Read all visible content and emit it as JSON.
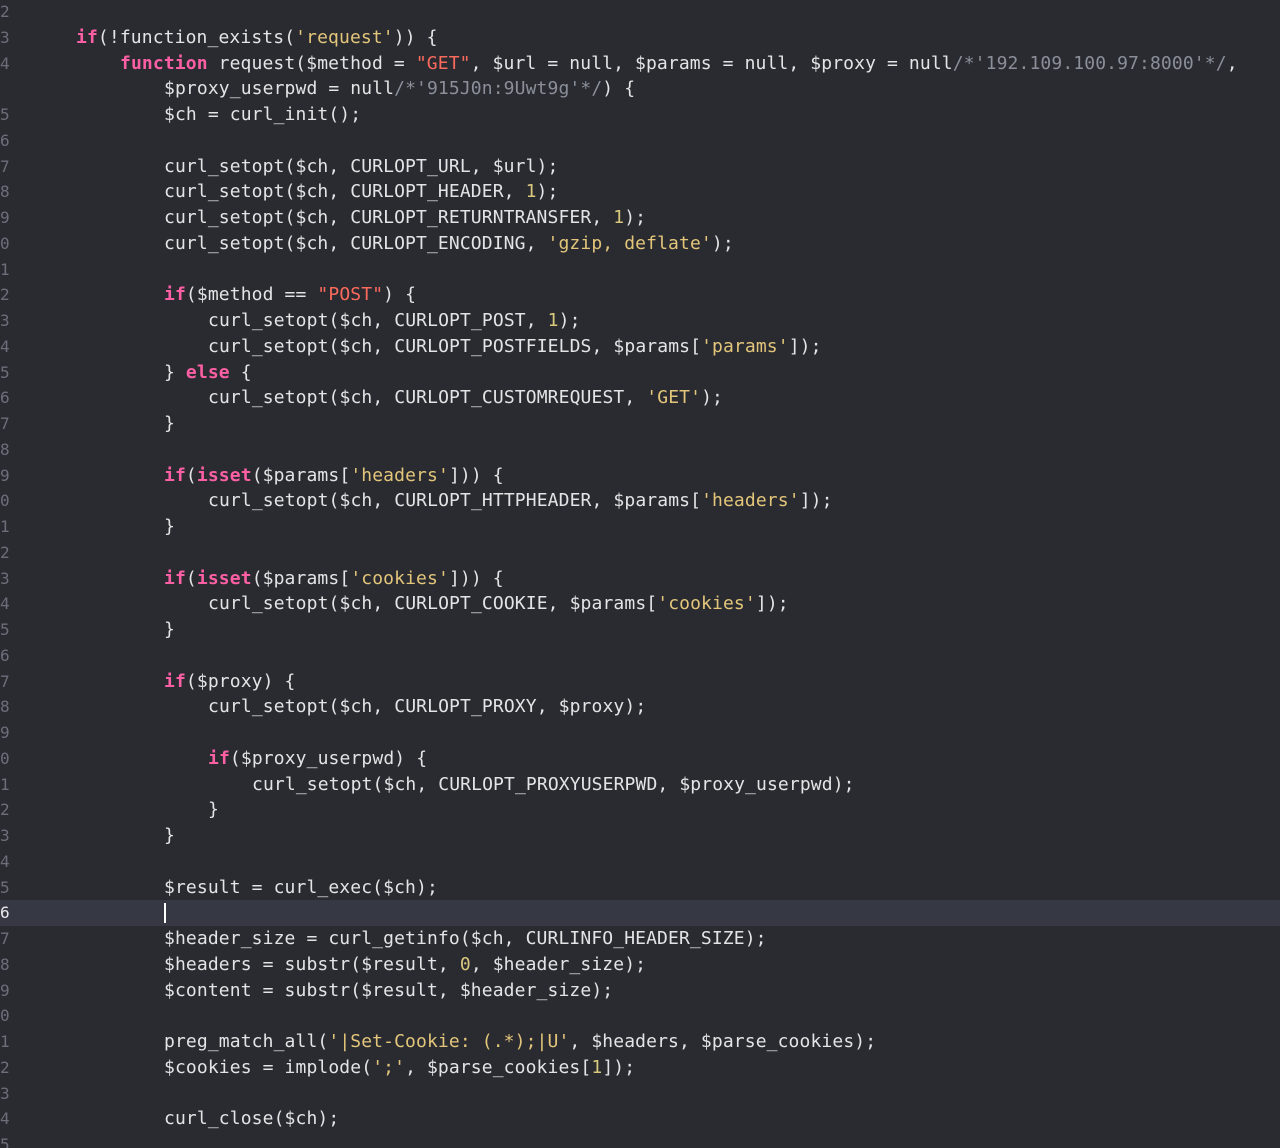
{
  "editor": {
    "theme_colors": {
      "background": "#2a2b31",
      "current_line": "#363944",
      "keyword": "#fc5fa3",
      "double_quoted_string": "#fc6a5d",
      "single_quoted_string": "#e3c67a",
      "number": "#d9c97c",
      "comment": "#8a8f99",
      "plain": "#e4e4e6",
      "line_number": "#6c6f7a"
    },
    "current_line_number": "6",
    "lines": [
      {
        "n": "2",
        "indent": 0,
        "tokens": []
      },
      {
        "n": "3",
        "indent": 1,
        "tokens": [
          {
            "t": "kw",
            "v": "if"
          },
          {
            "t": "pl",
            "v": "(!function_exists("
          },
          {
            "t": "sq",
            "v": "'request'"
          },
          {
            "t": "pl",
            "v": ")) {"
          }
        ]
      },
      {
        "n": "4",
        "indent": 2,
        "tokens": [
          {
            "t": "kw",
            "v": "function"
          },
          {
            "t": "pl",
            "v": " request($method = "
          },
          {
            "t": "str",
            "v": "\"GET\""
          },
          {
            "t": "pl",
            "v": ", $url = null, $params = null, $proxy = null"
          },
          {
            "t": "cm",
            "v": "/*'192.109.100.97:8000'*/"
          },
          {
            "t": "pl",
            "v": ","
          }
        ]
      },
      {
        "n": "",
        "indent": 3,
        "tokens": [
          {
            "t": "pl",
            "v": "$proxy_userpwd = null"
          },
          {
            "t": "cm",
            "v": "/*'915J0n:9Uwt9g'*/"
          },
          {
            "t": "pl",
            "v": ") {"
          }
        ]
      },
      {
        "n": "5",
        "indent": 3,
        "tokens": [
          {
            "t": "pl",
            "v": "$ch = curl_init();"
          }
        ]
      },
      {
        "n": "6",
        "indent": 0,
        "tokens": []
      },
      {
        "n": "7",
        "indent": 3,
        "tokens": [
          {
            "t": "pl",
            "v": "curl_setopt($ch, CURLOPT_URL, $url);"
          }
        ]
      },
      {
        "n": "8",
        "indent": 3,
        "tokens": [
          {
            "t": "pl",
            "v": "curl_setopt($ch, CURLOPT_HEADER, "
          },
          {
            "t": "num",
            "v": "1"
          },
          {
            "t": "pl",
            "v": ");"
          }
        ]
      },
      {
        "n": "9",
        "indent": 3,
        "tokens": [
          {
            "t": "pl",
            "v": "curl_setopt($ch, CURLOPT_RETURNTRANSFER, "
          },
          {
            "t": "num",
            "v": "1"
          },
          {
            "t": "pl",
            "v": ");"
          }
        ]
      },
      {
        "n": "0",
        "indent": 3,
        "tokens": [
          {
            "t": "pl",
            "v": "curl_setopt($ch, CURLOPT_ENCODING, "
          },
          {
            "t": "sq",
            "v": "'gzip, deflate'"
          },
          {
            "t": "pl",
            "v": ");"
          }
        ]
      },
      {
        "n": "1",
        "indent": 0,
        "tokens": []
      },
      {
        "n": "2",
        "indent": 3,
        "tokens": [
          {
            "t": "kw",
            "v": "if"
          },
          {
            "t": "pl",
            "v": "($method == "
          },
          {
            "t": "str",
            "v": "\"POST\""
          },
          {
            "t": "pl",
            "v": ") {"
          }
        ]
      },
      {
        "n": "3",
        "indent": 4,
        "tokens": [
          {
            "t": "pl",
            "v": "curl_setopt($ch, CURLOPT_POST, "
          },
          {
            "t": "num",
            "v": "1"
          },
          {
            "t": "pl",
            "v": ");"
          }
        ]
      },
      {
        "n": "4",
        "indent": 4,
        "tokens": [
          {
            "t": "pl",
            "v": "curl_setopt($ch, CURLOPT_POSTFIELDS, $params["
          },
          {
            "t": "sq",
            "v": "'params'"
          },
          {
            "t": "pl",
            "v": "]);"
          }
        ]
      },
      {
        "n": "5",
        "indent": 3,
        "tokens": [
          {
            "t": "pl",
            "v": "} "
          },
          {
            "t": "kw",
            "v": "else"
          },
          {
            "t": "pl",
            "v": " {"
          }
        ]
      },
      {
        "n": "6",
        "indent": 4,
        "tokens": [
          {
            "t": "pl",
            "v": "curl_setopt($ch, CURLOPT_CUSTOMREQUEST, "
          },
          {
            "t": "sq",
            "v": "'GET'"
          },
          {
            "t": "pl",
            "v": ");"
          }
        ]
      },
      {
        "n": "7",
        "indent": 3,
        "tokens": [
          {
            "t": "pl",
            "v": "}"
          }
        ]
      },
      {
        "n": "8",
        "indent": 0,
        "tokens": []
      },
      {
        "n": "9",
        "indent": 3,
        "tokens": [
          {
            "t": "kw",
            "v": "if"
          },
          {
            "t": "pl",
            "v": "("
          },
          {
            "t": "kw",
            "v": "isset"
          },
          {
            "t": "pl",
            "v": "($params["
          },
          {
            "t": "sq",
            "v": "'headers'"
          },
          {
            "t": "pl",
            "v": "])) {"
          }
        ]
      },
      {
        "n": "0",
        "indent": 4,
        "tokens": [
          {
            "t": "pl",
            "v": "curl_setopt($ch, CURLOPT_HTTPHEADER, $params["
          },
          {
            "t": "sq",
            "v": "'headers'"
          },
          {
            "t": "pl",
            "v": "]);"
          }
        ]
      },
      {
        "n": "1",
        "indent": 3,
        "tokens": [
          {
            "t": "pl",
            "v": "}"
          }
        ]
      },
      {
        "n": "2",
        "indent": 0,
        "tokens": []
      },
      {
        "n": "3",
        "indent": 3,
        "tokens": [
          {
            "t": "kw",
            "v": "if"
          },
          {
            "t": "pl",
            "v": "("
          },
          {
            "t": "kw",
            "v": "isset"
          },
          {
            "t": "pl",
            "v": "($params["
          },
          {
            "t": "sq",
            "v": "'cookies'"
          },
          {
            "t": "pl",
            "v": "])) {"
          }
        ]
      },
      {
        "n": "4",
        "indent": 4,
        "tokens": [
          {
            "t": "pl",
            "v": "curl_setopt($ch, CURLOPT_COOKIE, $params["
          },
          {
            "t": "sq",
            "v": "'cookies'"
          },
          {
            "t": "pl",
            "v": "]);"
          }
        ]
      },
      {
        "n": "5",
        "indent": 3,
        "tokens": [
          {
            "t": "pl",
            "v": "}"
          }
        ]
      },
      {
        "n": "6",
        "indent": 0,
        "tokens": []
      },
      {
        "n": "7",
        "indent": 3,
        "tokens": [
          {
            "t": "kw",
            "v": "if"
          },
          {
            "t": "pl",
            "v": "($proxy) {"
          }
        ]
      },
      {
        "n": "8",
        "indent": 4,
        "tokens": [
          {
            "t": "pl",
            "v": "curl_setopt($ch, CURLOPT_PROXY, $proxy);"
          }
        ]
      },
      {
        "n": "9",
        "indent": 0,
        "tokens": []
      },
      {
        "n": "0",
        "indent": 4,
        "tokens": [
          {
            "t": "kw",
            "v": "if"
          },
          {
            "t": "pl",
            "v": "($proxy_userpwd) {"
          }
        ]
      },
      {
        "n": "1",
        "indent": 5,
        "tokens": [
          {
            "t": "pl",
            "v": "curl_setopt($ch, CURLOPT_PROXYUSERPWD, $proxy_userpwd);"
          }
        ]
      },
      {
        "n": "2",
        "indent": 4,
        "tokens": [
          {
            "t": "pl",
            "v": "}"
          }
        ]
      },
      {
        "n": "3",
        "indent": 3,
        "tokens": [
          {
            "t": "pl",
            "v": "}"
          }
        ]
      },
      {
        "n": "4",
        "indent": 0,
        "tokens": []
      },
      {
        "n": "5",
        "indent": 3,
        "tokens": [
          {
            "t": "pl",
            "v": "$result = curl_exec($ch);"
          }
        ]
      },
      {
        "n": "6",
        "indent": 3,
        "current": true,
        "tokens": []
      },
      {
        "n": "7",
        "indent": 3,
        "tokens": [
          {
            "t": "pl",
            "v": "$header_size = curl_getinfo($ch, CURLINFO_HEADER_SIZE);"
          }
        ]
      },
      {
        "n": "8",
        "indent": 3,
        "tokens": [
          {
            "t": "pl",
            "v": "$headers = substr($result, "
          },
          {
            "t": "num",
            "v": "0"
          },
          {
            "t": "pl",
            "v": ", $header_size);"
          }
        ]
      },
      {
        "n": "9",
        "indent": 3,
        "tokens": [
          {
            "t": "pl",
            "v": "$content = substr($result, $header_size);"
          }
        ]
      },
      {
        "n": "0",
        "indent": 0,
        "tokens": []
      },
      {
        "n": "1",
        "indent": 3,
        "tokens": [
          {
            "t": "pl",
            "v": "preg_match_all("
          },
          {
            "t": "sq",
            "v": "'|Set-Cookie: (.*);|U'"
          },
          {
            "t": "pl",
            "v": ", $headers, $parse_cookies);"
          }
        ]
      },
      {
        "n": "2",
        "indent": 3,
        "tokens": [
          {
            "t": "pl",
            "v": "$cookies = implode("
          },
          {
            "t": "sq",
            "v": "';'"
          },
          {
            "t": "pl",
            "v": ", $parse_cookies["
          },
          {
            "t": "num",
            "v": "1"
          },
          {
            "t": "pl",
            "v": "]);"
          }
        ]
      },
      {
        "n": "3",
        "indent": 0,
        "tokens": []
      },
      {
        "n": "4",
        "indent": 3,
        "tokens": [
          {
            "t": "pl",
            "v": "curl_close($ch);"
          }
        ]
      },
      {
        "n": "5",
        "indent": 0,
        "tokens": []
      }
    ]
  }
}
